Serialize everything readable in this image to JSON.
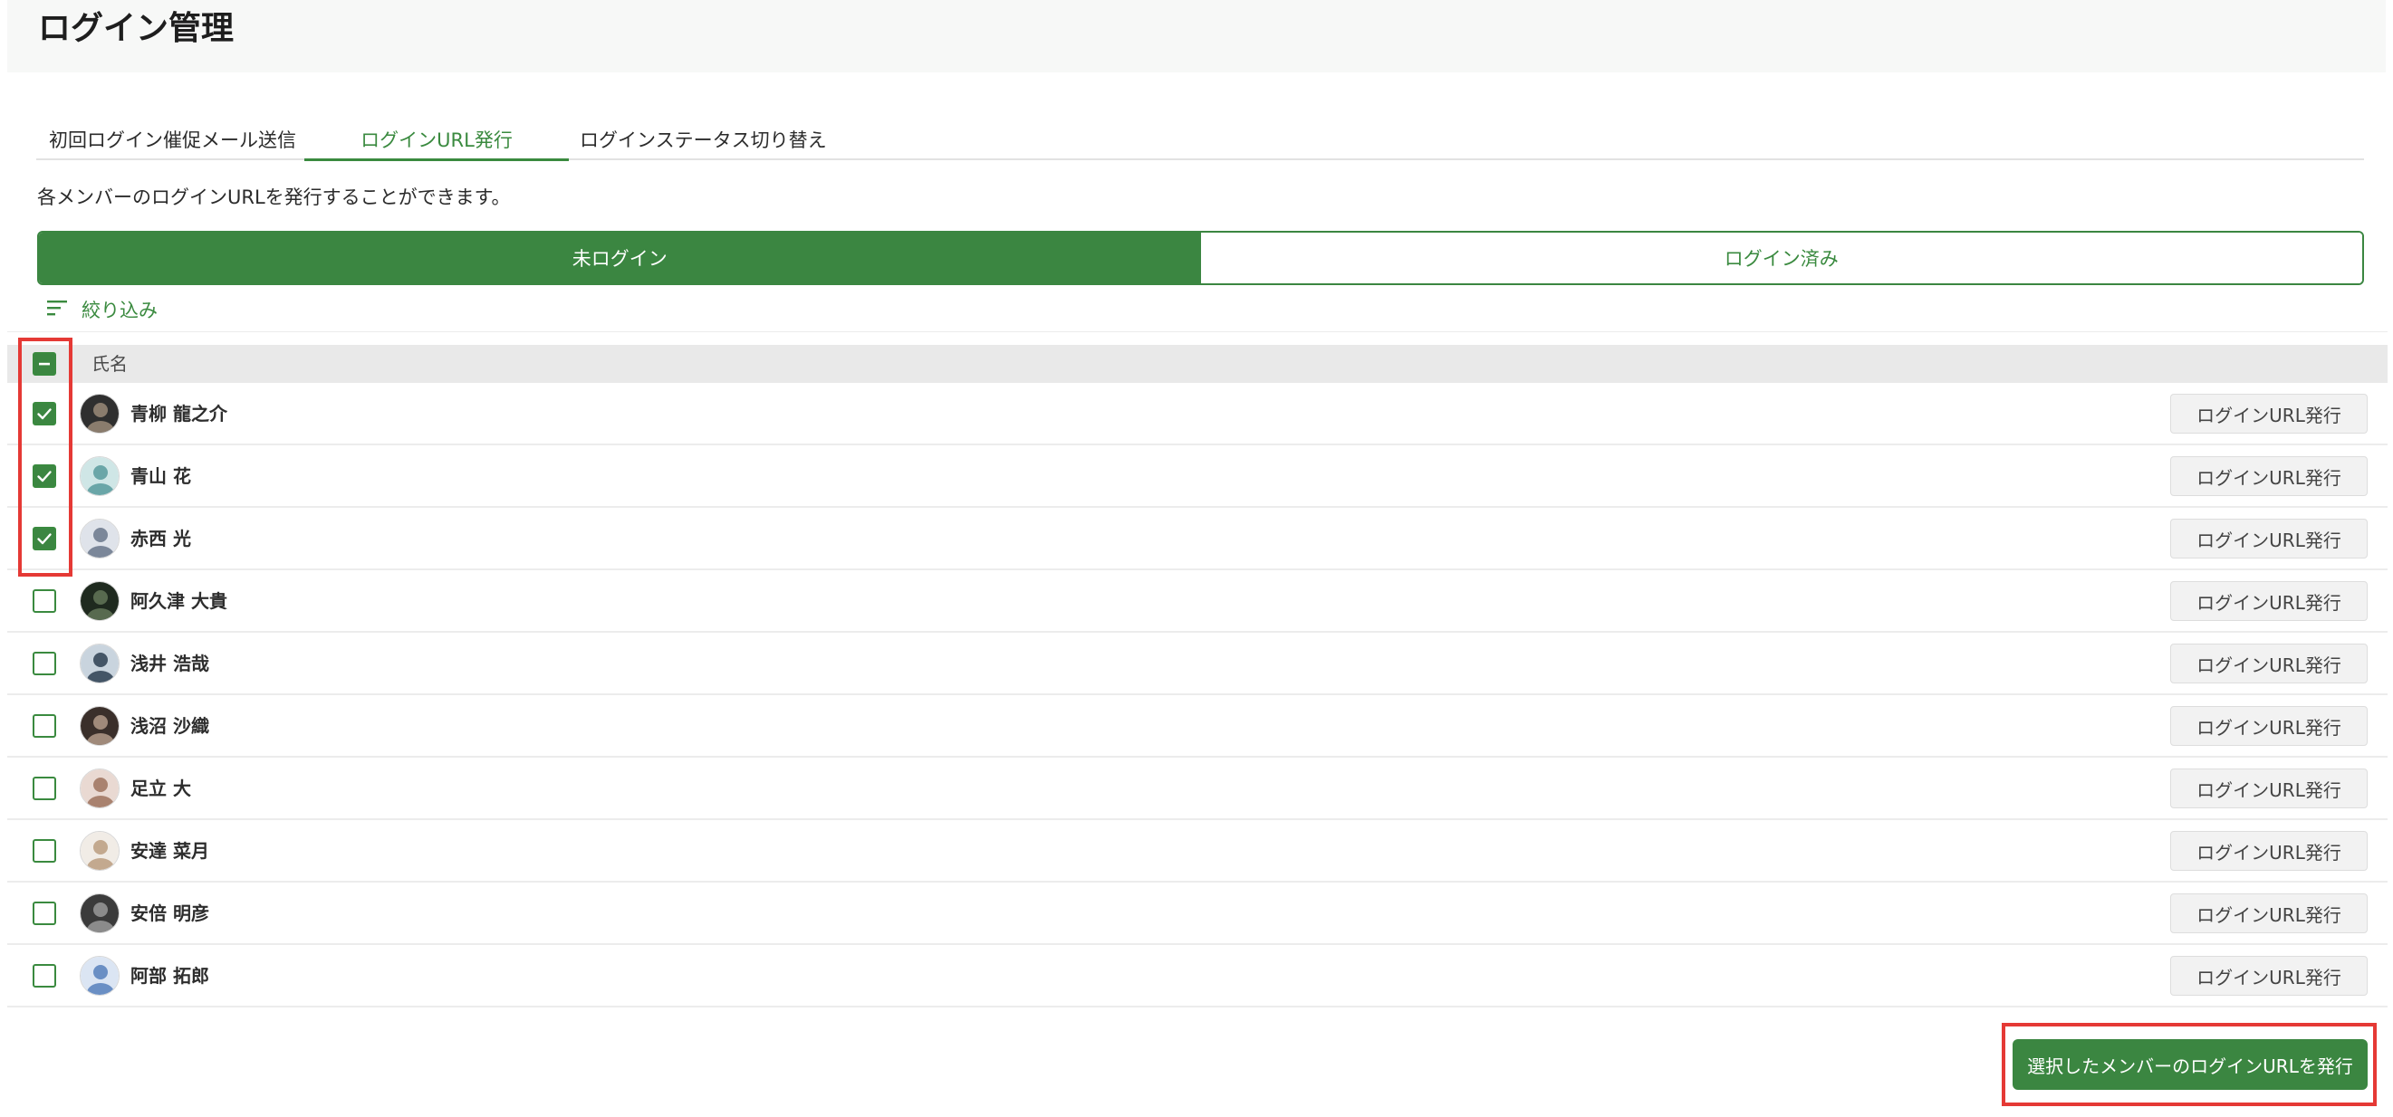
{
  "page": {
    "title": "ログイン管理",
    "description": "各メンバーのログインURLを発行することができます。"
  },
  "tabs": [
    {
      "label": "初回ログイン催促メール送信",
      "active": false
    },
    {
      "label": "ログインURL発行",
      "active": true
    },
    {
      "label": "ログインステータス切り替え",
      "active": false
    }
  ],
  "segment": {
    "options": [
      "未ログイン",
      "ログイン済み"
    ],
    "selected": "未ログイン"
  },
  "filter": {
    "label": "絞り込み",
    "icon": "filter-icon"
  },
  "table": {
    "header_name": "氏名",
    "header_checkbox_state": "indeterminate",
    "row_button_label": "ログインURL発行",
    "rows": [
      {
        "name": "青柳 龍之介",
        "checked": true
      },
      {
        "name": "青山 花",
        "checked": true
      },
      {
        "name": "赤西 光",
        "checked": true
      },
      {
        "name": "阿久津 大貴",
        "checked": false
      },
      {
        "name": "浅井 浩哉",
        "checked": false
      },
      {
        "name": "浅沼 沙織",
        "checked": false
      },
      {
        "name": "足立 大",
        "checked": false
      },
      {
        "name": "安達 菜月",
        "checked": false
      },
      {
        "name": "安倍 明彦",
        "checked": false
      },
      {
        "name": "阿部 拓郎",
        "checked": false
      }
    ]
  },
  "footer": {
    "issue_selected_label": "選択したメンバーのログインURLを発行"
  },
  "colors": {
    "accent": "#3b8641",
    "highlight": "#e53935",
    "header_bg": "#e9e9e9"
  }
}
